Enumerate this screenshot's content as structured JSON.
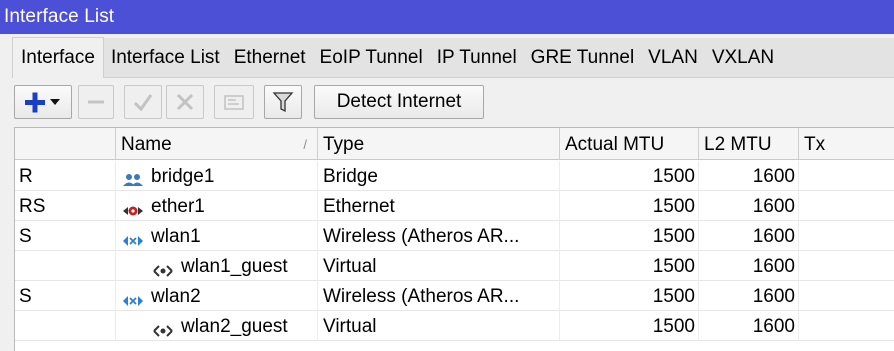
{
  "window": {
    "title": "Interface List"
  },
  "tabs": [
    {
      "label": "Interface",
      "active": true
    },
    {
      "label": "Interface List"
    },
    {
      "label": "Ethernet"
    },
    {
      "label": "EoIP Tunnel"
    },
    {
      "label": "IP Tunnel"
    },
    {
      "label": "GRE Tunnel"
    },
    {
      "label": "VLAN"
    },
    {
      "label": "VXLAN"
    }
  ],
  "toolbar": {
    "detect_label": "Detect Internet",
    "icons": [
      "add-dropdown-icon",
      "remove-icon",
      "enable-check-icon",
      "disable-x-icon",
      "comment-icon",
      "filter-icon"
    ],
    "accent": "#1b3fc4"
  },
  "table": {
    "columns": [
      "",
      "Name",
      "Type",
      "Actual MTU",
      "L2 MTU",
      "Tx"
    ],
    "sort_indicator": "/",
    "rows": [
      {
        "flags": "R",
        "name": "bridge1",
        "icon": "bridge-icon",
        "type": "Bridge",
        "mtu": "1500",
        "l2mtu": "1600",
        "tx": ""
      },
      {
        "flags": "RS",
        "name": "ether1",
        "icon": "ethernet-icon",
        "type": "Ethernet",
        "mtu": "1500",
        "l2mtu": "1600",
        "tx": ""
      },
      {
        "flags": "S",
        "name": "wlan1",
        "icon": "wireless-icon",
        "type": "Wireless (Atheros AR...",
        "mtu": "1500",
        "l2mtu": "1600",
        "tx": ""
      },
      {
        "flags": "",
        "name": "wlan1_guest",
        "icon": "virtual-icon",
        "type": "Virtual",
        "mtu": "1500",
        "l2mtu": "1600",
        "tx": ""
      },
      {
        "flags": "S",
        "name": "wlan2",
        "icon": "wireless-icon",
        "type": "Wireless (Atheros AR...",
        "mtu": "1500",
        "l2mtu": "1600",
        "tx": ""
      },
      {
        "flags": "",
        "name": "wlan2_guest",
        "icon": "virtual-icon",
        "type": "Virtual",
        "mtu": "1500",
        "l2mtu": "1600",
        "tx": ""
      }
    ]
  }
}
